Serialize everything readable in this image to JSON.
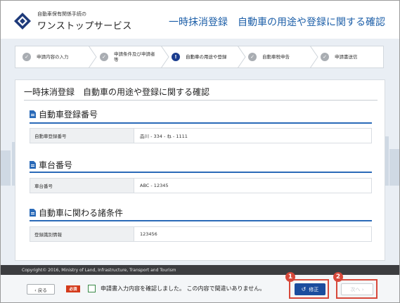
{
  "header": {
    "logo_small": "自動車保有関係手続の",
    "logo_big": "ワンストップサービス",
    "title": "一時抹消登録　自動車の用途や登録に関する確認"
  },
  "steps": [
    {
      "label": "申請内容の入力",
      "icon": "check-icon",
      "active": false
    },
    {
      "label": "申請条件及び申請者等",
      "icon": "check-icon",
      "active": false
    },
    {
      "label": "自動車の用途や登録",
      "icon": "exclamation-icon",
      "active": true
    },
    {
      "label": "自動車税申告",
      "icon": "check-icon",
      "active": false
    },
    {
      "label": "申請書送信",
      "icon": "check-icon",
      "active": false
    }
  ],
  "main": {
    "page_title": "一時抹消登録　自動車の用途や登録に関する確認",
    "sections": [
      {
        "heading": "自動車登録番号",
        "rows": [
          {
            "key": "自動車登録番号",
            "value": "品川 - 334 - ね - 1111"
          }
        ]
      },
      {
        "heading": "車台番号",
        "rows": [
          {
            "key": "車台番号",
            "value": "ABC - 12345"
          }
        ]
      },
      {
        "heading": "自動車に関わる諸条件",
        "rows": [
          {
            "key": "登録識別情報",
            "value": "123456"
          }
        ]
      }
    ]
  },
  "footer": {
    "copyright": "Copyright© 2016, Ministry of Land, Infrastructure, Transport and Tourism"
  },
  "actions": {
    "back_label": "‹ 戻る",
    "required_badge": "必須",
    "confirm_text": "申請書入力内容を確認しました。 この内容で間違いありません。",
    "edit_label": "修正",
    "next_label": "次へ ›",
    "marker1": "1",
    "marker2": "2"
  },
  "colors": {
    "accent": "#1b4d9e",
    "highlight": "#d7483a",
    "required": "#d43a1b"
  }
}
